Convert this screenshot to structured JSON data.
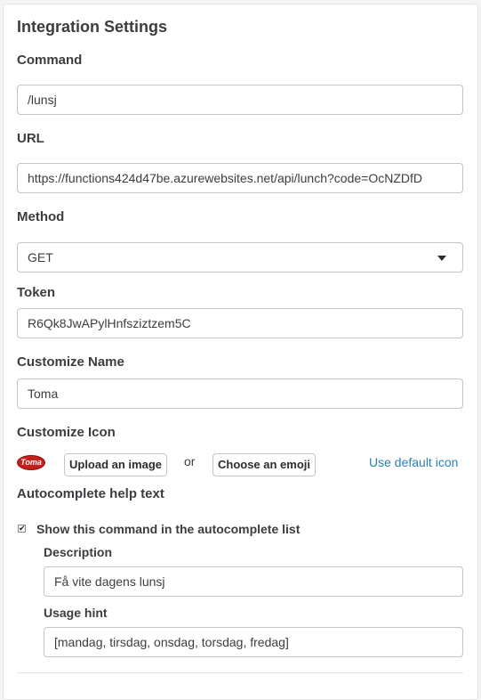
{
  "title": "Integration Settings",
  "command": {
    "label": "Command",
    "value": "/lunsj"
  },
  "url": {
    "label": "URL",
    "value": "https://functions424d47be.azurewebsites.net/api/lunch?code=OcNZDfD"
  },
  "method": {
    "label": "Method",
    "value": "GET"
  },
  "token": {
    "label": "Token",
    "value": "R6Qk8JwAPylHnfsziztzem5C"
  },
  "customize_name": {
    "label": "Customize Name",
    "value": "Toma"
  },
  "customize_icon": {
    "label": "Customize Icon",
    "logo_text": "Toma",
    "upload_label": "Upload an image",
    "or_text": "or",
    "emoji_label": "Choose an emoji",
    "default_link": "Use default icon"
  },
  "autocomplete": {
    "label": "Autocomplete help text",
    "show_checkbox_label": "Show this command in the autocomplete list",
    "checked": true,
    "description_label": "Description",
    "description_value": "Få vite dagens lunsj",
    "usage_label": "Usage hint",
    "usage_value": "[mandag, tirsdag, onsdag, torsdag, fredag]"
  },
  "colors": {
    "link": "#2a80b9",
    "logo_red": "#c81e1e",
    "border": "#c5c5c5"
  }
}
